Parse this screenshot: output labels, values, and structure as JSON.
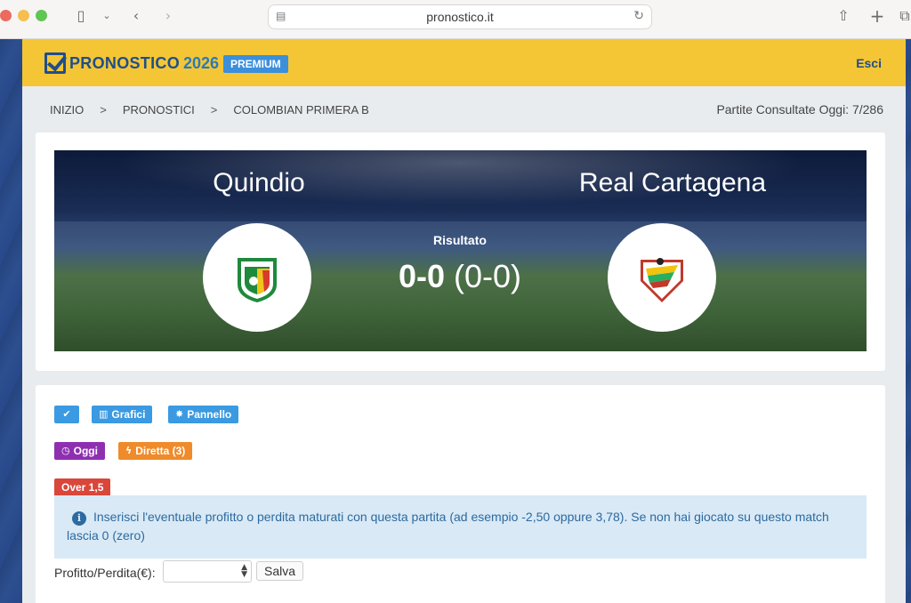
{
  "browser": {
    "url": "pronostico.it"
  },
  "header": {
    "logo_text": "PRONOSTICO",
    "logo_year": "2026",
    "premium_badge": "PREMIUM",
    "logout": "Esci",
    "brand_color": "#f4c635"
  },
  "breadcrumb": {
    "items": [
      "INIZIO",
      "PRONOSTICI",
      "COLOMBIAN PRIMERA B"
    ],
    "separator": ">"
  },
  "counter": "Partite Consultate Oggi: 7/286",
  "match": {
    "home_team": "Quindio",
    "away_team": "Real Cartagena",
    "result_label": "Risultato",
    "score_full": "0-0",
    "score_half": "(0-0)"
  },
  "actions": {
    "check_icon": "✔",
    "grafici": "Grafici",
    "pannello": "Pannello",
    "oggi": "Oggi",
    "diretta": "Diretta (3)",
    "tip": "Over 1,5"
  },
  "info_alert": {
    "icon": "i",
    "text": "Inserisci l'eventuale profitto o perdita maturati con questa partita (ad esempio -2,50 oppure 3,78). Se non hai giocato su questo match lascia 0 (zero)"
  },
  "profit_form": {
    "label": "Profitto/Perdita(€):",
    "value": "",
    "save_label": "Salva"
  }
}
